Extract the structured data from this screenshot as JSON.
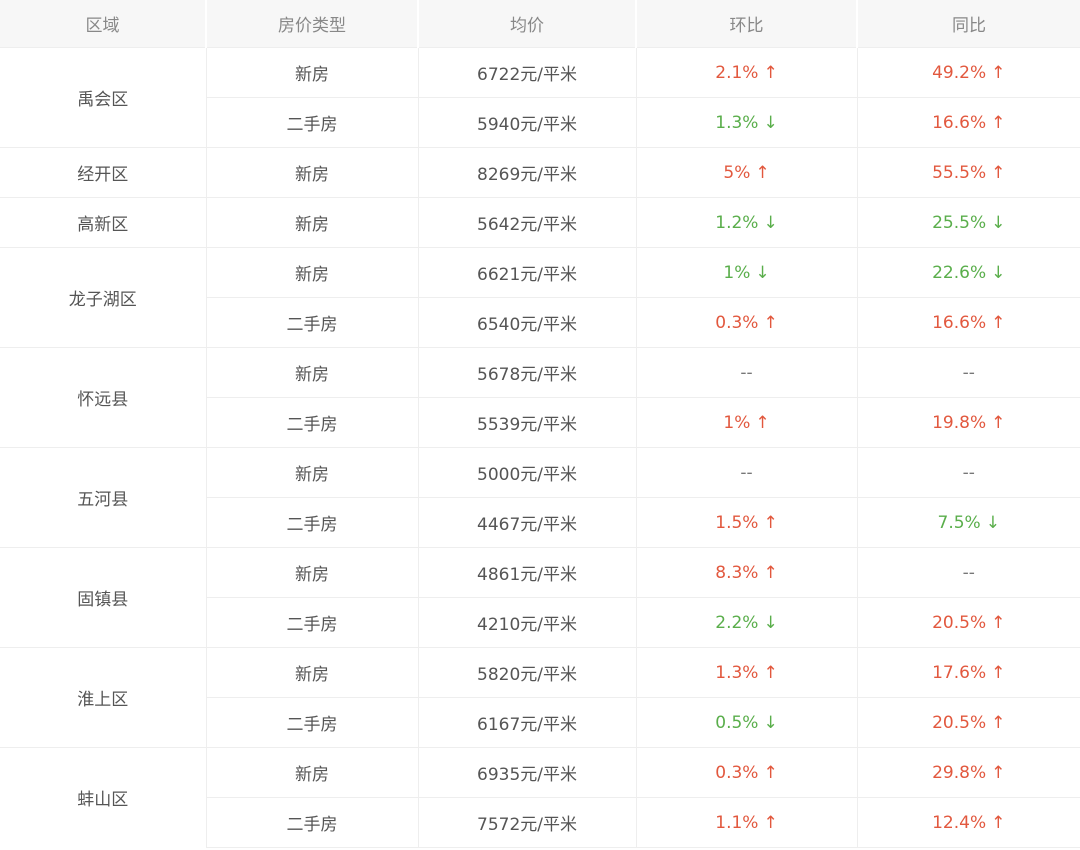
{
  "headers": [
    "区域",
    "房价类型",
    "均价",
    "环比",
    "同比"
  ],
  "colors": {
    "up": "#e2583e",
    "down": "#5aae4b",
    "header_bg": "#f7f7f7"
  },
  "arrow_icons": {
    "up": "↑",
    "down": "↓"
  },
  "districts": [
    {
      "name": "禹会区",
      "rows": [
        {
          "type": "新房",
          "price": "6722元/平米",
          "mom": {
            "value": "2.1%",
            "dir": "up"
          },
          "yoy": {
            "value": "49.2%",
            "dir": "up"
          }
        },
        {
          "type": "二手房",
          "price": "5940元/平米",
          "mom": {
            "value": "1.3%",
            "dir": "down"
          },
          "yoy": {
            "value": "16.6%",
            "dir": "up"
          }
        }
      ]
    },
    {
      "name": "经开区",
      "rows": [
        {
          "type": "新房",
          "price": "8269元/平米",
          "mom": {
            "value": "5%",
            "dir": "up"
          },
          "yoy": {
            "value": "55.5%",
            "dir": "up"
          }
        }
      ]
    },
    {
      "name": "高新区",
      "rows": [
        {
          "type": "新房",
          "price": "5642元/平米",
          "mom": {
            "value": "1.2%",
            "dir": "down"
          },
          "yoy": {
            "value": "25.5%",
            "dir": "down"
          }
        }
      ]
    },
    {
      "name": "龙子湖区",
      "rows": [
        {
          "type": "新房",
          "price": "6621元/平米",
          "mom": {
            "value": "1%",
            "dir": "down"
          },
          "yoy": {
            "value": "22.6%",
            "dir": "down"
          }
        },
        {
          "type": "二手房",
          "price": "6540元/平米",
          "mom": {
            "value": "0.3%",
            "dir": "up"
          },
          "yoy": {
            "value": "16.6%",
            "dir": "up"
          }
        }
      ]
    },
    {
      "name": "怀远县",
      "rows": [
        {
          "type": "新房",
          "price": "5678元/平米",
          "mom": {
            "value": "--",
            "dir": "none"
          },
          "yoy": {
            "value": "--",
            "dir": "none"
          }
        },
        {
          "type": "二手房",
          "price": "5539元/平米",
          "mom": {
            "value": "1%",
            "dir": "up"
          },
          "yoy": {
            "value": "19.8%",
            "dir": "up"
          }
        }
      ]
    },
    {
      "name": "五河县",
      "rows": [
        {
          "type": "新房",
          "price": "5000元/平米",
          "mom": {
            "value": "--",
            "dir": "none"
          },
          "yoy": {
            "value": "--",
            "dir": "none"
          }
        },
        {
          "type": "二手房",
          "price": "4467元/平米",
          "mom": {
            "value": "1.5%",
            "dir": "up"
          },
          "yoy": {
            "value": "7.5%",
            "dir": "down"
          }
        }
      ]
    },
    {
      "name": "固镇县",
      "rows": [
        {
          "type": "新房",
          "price": "4861元/平米",
          "mom": {
            "value": "8.3%",
            "dir": "up"
          },
          "yoy": {
            "value": "--",
            "dir": "none"
          }
        },
        {
          "type": "二手房",
          "price": "4210元/平米",
          "mom": {
            "value": "2.2%",
            "dir": "down"
          },
          "yoy": {
            "value": "20.5%",
            "dir": "up"
          }
        }
      ]
    },
    {
      "name": "淮上区",
      "rows": [
        {
          "type": "新房",
          "price": "5820元/平米",
          "mom": {
            "value": "1.3%",
            "dir": "up"
          },
          "yoy": {
            "value": "17.6%",
            "dir": "up"
          }
        },
        {
          "type": "二手房",
          "price": "6167元/平米",
          "mom": {
            "value": "0.5%",
            "dir": "down"
          },
          "yoy": {
            "value": "20.5%",
            "dir": "up"
          }
        }
      ]
    },
    {
      "name": "蚌山区",
      "rows": [
        {
          "type": "新房",
          "price": "6935元/平米",
          "mom": {
            "value": "0.3%",
            "dir": "up"
          },
          "yoy": {
            "value": "29.8%",
            "dir": "up"
          }
        },
        {
          "type": "二手房",
          "price": "7572元/平米",
          "mom": {
            "value": "1.1%",
            "dir": "up"
          },
          "yoy": {
            "value": "12.4%",
            "dir": "up"
          }
        }
      ]
    }
  ]
}
